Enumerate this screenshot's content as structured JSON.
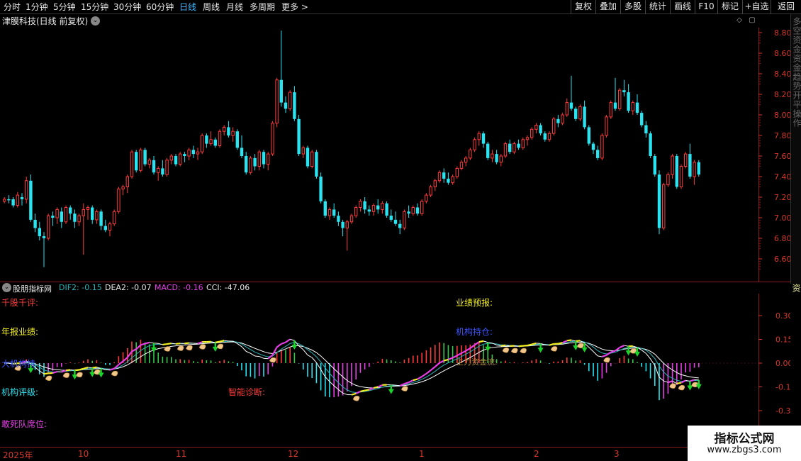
{
  "toolbar": {
    "periods": [
      "分时",
      "1分钟",
      "5分钟",
      "15分钟",
      "30分钟",
      "60分钟",
      "日线",
      "周线",
      "月线",
      "多周期",
      "更多 >"
    ],
    "active_period": "日线",
    "tools": [
      "复权",
      "叠加",
      "多股",
      "统计",
      "画线",
      "F10",
      "标记",
      "+自选",
      "返回"
    ]
  },
  "stock": {
    "title": "津膜科技(日线 前复权)"
  },
  "price_axis": [
    "8.80",
    "8.60",
    "8.40",
    "8.20",
    "8.00",
    "7.80",
    "7.60",
    "7.40",
    "7.20",
    "7.00",
    "6.80",
    "6.60"
  ],
  "indicator": {
    "name": "股朋指标网",
    "dif_label": "DIF2: -0.15",
    "dea_label": "DEA2: -0.07",
    "macd_label": "MACD: -0.16",
    "cci_label": "CCI: -47.06",
    "axis": [
      "0.30",
      "0.15",
      "0.00",
      "-0.15",
      "-0.30"
    ]
  },
  "annotations": {
    "qiangu": "千股千评:",
    "nianbao": "年报业绩:",
    "blue_left": "大机构持",
    "jigou": "机构评级:",
    "zhineng": "智能诊断:",
    "gansi": "敢死队席位:",
    "yeji": "业绩预报:",
    "blue_mid": "机构持仓:",
    "zhuli": "主力资金流:"
  },
  "right_strip": {
    "top_text": "多空资金资金趋势开平操作",
    "bottom_text": "资"
  },
  "dates": [
    "2025年",
    "10",
    "11",
    "12",
    "1",
    "2",
    "3"
  ],
  "watermark": {
    "title": "指标公式网",
    "url": "www.zbgs3.com"
  },
  "colors": {
    "up": "#ff3b3b",
    "down": "#29e3f0",
    "axis": "#d8372a",
    "magenta": "#e83ee8",
    "yellow": "#f5f020",
    "white_line": "#ffffff",
    "teal_line": "#2ab3b8"
  },
  "chart_data": {
    "type": "candlestick",
    "candles": [
      [
        7.16,
        7.2,
        7.14,
        7.18
      ],
      [
        7.18,
        7.22,
        7.14,
        7.17
      ],
      [
        7.18,
        7.2,
        7.1,
        7.12
      ],
      [
        7.12,
        7.25,
        7.1,
        7.22
      ],
      [
        7.2,
        7.24,
        7.12,
        7.18
      ],
      [
        7.18,
        7.4,
        7.14,
        7.36
      ],
      [
        7.36,
        7.42,
        6.96,
        6.98
      ],
      [
        6.98,
        7.04,
        6.86,
        6.9
      ],
      [
        6.9,
        6.96,
        6.78,
        6.82
      ],
      [
        6.82,
        6.86,
        6.52,
        6.8
      ],
      [
        6.8,
        7.04,
        6.78,
        7.02
      ],
      [
        7.02,
        7.06,
        6.92,
        7.0
      ],
      [
        7.0,
        7.1,
        6.94,
        7.08
      ],
      [
        7.06,
        7.1,
        6.9,
        6.96
      ],
      [
        6.96,
        7.12,
        6.94,
        7.1
      ],
      [
        7.1,
        7.12,
        6.98,
        7.04
      ],
      [
        7.04,
        7.08,
        6.9,
        6.96
      ],
      [
        6.96,
        7.04,
        6.92,
        7.02
      ],
      [
        7.02,
        7.14,
        6.64,
        7.08
      ],
      [
        7.08,
        7.12,
        6.98,
        7.1
      ],
      [
        7.1,
        7.12,
        6.94,
        6.98
      ],
      [
        6.98,
        7.08,
        6.94,
        7.06
      ],
      [
        7.06,
        7.08,
        6.88,
        6.92
      ],
      [
        6.92,
        6.98,
        6.86,
        6.88
      ],
      [
        6.88,
        6.96,
        6.82,
        6.94
      ],
      [
        6.94,
        7.08,
        6.92,
        7.06
      ],
      [
        7.06,
        7.3,
        7.04,
        7.28
      ],
      [
        7.28,
        7.32,
        7.22,
        7.3
      ],
      [
        7.3,
        7.42,
        7.24,
        7.4
      ],
      [
        7.4,
        7.66,
        7.38,
        7.64
      ],
      [
        7.64,
        7.66,
        7.44,
        7.46
      ],
      [
        7.46,
        7.68,
        7.44,
        7.66
      ],
      [
        7.66,
        7.68,
        7.5,
        7.52
      ],
      [
        7.52,
        7.58,
        7.48,
        7.56
      ],
      [
        7.56,
        7.6,
        7.42,
        7.44
      ],
      [
        7.44,
        7.5,
        7.36,
        7.48
      ],
      [
        7.48,
        7.56,
        7.4,
        7.42
      ],
      [
        7.42,
        7.58,
        7.4,
        7.56
      ],
      [
        7.56,
        7.62,
        7.52,
        7.6
      ],
      [
        7.6,
        7.62,
        7.5,
        7.52
      ],
      [
        7.52,
        7.64,
        7.5,
        7.62
      ],
      [
        7.62,
        7.64,
        7.54,
        7.6
      ],
      [
        7.6,
        7.68,
        7.56,
        7.66
      ],
      [
        7.66,
        7.7,
        7.58,
        7.62
      ],
      [
        7.62,
        7.68,
        7.56,
        7.64
      ],
      [
        7.64,
        7.82,
        7.62,
        7.8
      ],
      [
        7.8,
        7.82,
        7.68,
        7.72
      ],
      [
        7.72,
        7.84,
        7.7,
        7.76
      ],
      [
        7.76,
        7.78,
        7.68,
        7.7
      ],
      [
        7.7,
        7.86,
        7.68,
        7.84
      ],
      [
        7.84,
        7.9,
        7.8,
        7.88
      ],
      [
        7.88,
        7.94,
        7.78,
        7.8
      ],
      [
        7.8,
        7.88,
        7.74,
        7.84
      ],
      [
        7.84,
        7.86,
        7.66,
        7.68
      ],
      [
        7.68,
        7.8,
        7.58,
        7.6
      ],
      [
        7.6,
        7.64,
        7.42,
        7.44
      ],
      [
        7.44,
        7.6,
        7.42,
        7.58
      ],
      [
        7.58,
        7.62,
        7.46,
        7.5
      ],
      [
        7.5,
        7.66,
        7.46,
        7.64
      ],
      [
        7.64,
        7.66,
        7.48,
        7.52
      ],
      [
        7.52,
        7.64,
        7.46,
        7.62
      ],
      [
        7.62,
        7.94,
        7.6,
        7.92
      ],
      [
        7.92,
        8.36,
        7.88,
        8.34
      ],
      [
        8.34,
        8.82,
        8.08,
        8.12
      ],
      [
        8.12,
        8.18,
        8.02,
        8.06
      ],
      [
        8.06,
        8.24,
        8.04,
        8.22
      ],
      [
        8.22,
        8.28,
        7.94,
        7.96
      ],
      [
        7.96,
        8.0,
        7.6,
        7.62
      ],
      [
        7.62,
        7.7,
        7.58,
        7.68
      ],
      [
        7.68,
        7.7,
        7.48,
        7.5
      ],
      [
        7.5,
        7.66,
        7.48,
        7.64
      ],
      [
        7.64,
        7.66,
        7.38,
        7.4
      ],
      [
        7.4,
        7.44,
        7.14,
        7.16
      ],
      [
        7.16,
        7.18,
        7.0,
        7.02
      ],
      [
        7.02,
        7.1,
        6.98,
        7.08
      ],
      [
        7.08,
        7.14,
        7.0,
        7.02
      ],
      [
        7.02,
        7.06,
        6.92,
        6.96
      ],
      [
        6.96,
        6.98,
        6.82,
        6.9
      ],
      [
        6.9,
        6.98,
        6.68,
        6.96
      ],
      [
        6.96,
        7.04,
        6.94,
        7.02
      ],
      [
        7.02,
        7.12,
        7.0,
        7.1
      ],
      [
        7.1,
        7.18,
        7.06,
        7.16
      ],
      [
        7.16,
        7.2,
        7.04,
        7.08
      ],
      [
        7.08,
        7.12,
        7.02,
        7.06
      ],
      [
        7.06,
        7.14,
        7.02,
        7.12
      ],
      [
        7.12,
        7.18,
        7.04,
        7.08
      ],
      [
        7.08,
        7.16,
        7.04,
        7.14
      ],
      [
        7.14,
        7.16,
        7.0,
        7.02
      ],
      [
        7.02,
        7.08,
        6.96,
        6.98
      ],
      [
        6.98,
        7.06,
        6.92,
        6.94
      ],
      [
        6.94,
        6.98,
        6.84,
        6.9
      ],
      [
        6.9,
        7.08,
        6.88,
        7.06
      ],
      [
        7.06,
        7.12,
        7.0,
        7.04
      ],
      [
        7.04,
        7.12,
        7.02,
        7.1
      ],
      [
        7.1,
        7.14,
        7.02,
        7.04
      ],
      [
        7.04,
        7.18,
        7.02,
        7.16
      ],
      [
        7.16,
        7.24,
        7.14,
        7.22
      ],
      [
        7.22,
        7.32,
        7.2,
        7.3
      ],
      [
        7.3,
        7.38,
        7.26,
        7.36
      ],
      [
        7.36,
        7.46,
        7.34,
        7.44
      ],
      [
        7.44,
        7.48,
        7.34,
        7.38
      ],
      [
        7.38,
        7.44,
        7.32,
        7.34
      ],
      [
        7.34,
        7.42,
        7.32,
        7.4
      ],
      [
        7.4,
        7.5,
        7.38,
        7.48
      ],
      [
        7.48,
        7.56,
        7.46,
        7.54
      ],
      [
        7.54,
        7.6,
        7.5,
        7.58
      ],
      [
        7.58,
        7.68,
        7.56,
        7.66
      ],
      [
        7.66,
        7.78,
        7.64,
        7.76
      ],
      [
        7.76,
        7.84,
        7.7,
        7.82
      ],
      [
        7.82,
        7.84,
        7.68,
        7.72
      ],
      [
        7.72,
        7.74,
        7.56,
        7.58
      ],
      [
        7.58,
        7.66,
        7.54,
        7.62
      ],
      [
        7.62,
        7.66,
        7.52,
        7.54
      ],
      [
        7.54,
        7.62,
        7.5,
        7.6
      ],
      [
        7.6,
        7.74,
        7.58,
        7.72
      ],
      [
        7.72,
        7.76,
        7.62,
        7.64
      ],
      [
        7.64,
        7.74,
        7.62,
        7.72
      ],
      [
        7.72,
        7.76,
        7.66,
        7.68
      ],
      [
        7.68,
        7.78,
        7.66,
        7.76
      ],
      [
        7.76,
        7.8,
        7.7,
        7.78
      ],
      [
        7.78,
        7.88,
        7.76,
        7.86
      ],
      [
        7.86,
        7.92,
        7.82,
        7.9
      ],
      [
        7.9,
        7.92,
        7.8,
        7.82
      ],
      [
        7.82,
        7.84,
        7.74,
        7.76
      ],
      [
        7.76,
        7.84,
        7.74,
        7.82
      ],
      [
        7.82,
        7.98,
        7.8,
        7.96
      ],
      [
        7.96,
        8.0,
        7.88,
        7.92
      ],
      [
        7.92,
        8.02,
        7.9,
        8.0
      ],
      [
        8.0,
        8.16,
        7.98,
        8.12
      ],
      [
        8.12,
        8.38,
        8.04,
        8.06
      ],
      [
        8.06,
        8.08,
        7.94,
        7.96
      ],
      [
        7.96,
        8.1,
        7.94,
        8.08
      ],
      [
        8.08,
        8.14,
        7.86,
        7.88
      ],
      [
        7.88,
        7.9,
        7.7,
        7.72
      ],
      [
        7.72,
        7.74,
        7.62,
        7.66
      ],
      [
        7.66,
        7.7,
        7.56,
        7.58
      ],
      [
        7.58,
        7.82,
        7.56,
        7.8
      ],
      [
        7.8,
        8.0,
        7.78,
        7.98
      ],
      [
        7.98,
        8.14,
        7.96,
        8.12
      ],
      [
        8.12,
        8.36,
        8.04,
        8.06
      ],
      [
        8.06,
        8.26,
        8.04,
        8.24
      ],
      [
        8.24,
        8.34,
        8.18,
        8.22
      ],
      [
        8.22,
        8.3,
        8.02,
        8.04
      ],
      [
        8.04,
        8.14,
        8.0,
        8.12
      ],
      [
        8.12,
        8.2,
        8.0,
        8.02
      ],
      [
        8.02,
        8.04,
        7.88,
        7.9
      ],
      [
        7.9,
        7.94,
        7.78,
        7.82
      ],
      [
        7.82,
        7.84,
        7.58,
        7.6
      ],
      [
        7.6,
        7.62,
        7.4,
        7.42
      ],
      [
        7.42,
        7.46,
        6.84,
        6.9
      ],
      [
        6.9,
        7.34,
        6.88,
        7.32
      ],
      [
        7.32,
        7.44,
        7.3,
        7.42
      ],
      [
        7.42,
        7.62,
        7.38,
        7.6
      ],
      [
        7.6,
        7.62,
        7.28,
        7.3
      ],
      [
        7.3,
        7.52,
        7.28,
        7.5
      ],
      [
        7.5,
        7.64,
        7.48,
        7.62
      ],
      [
        7.62,
        7.72,
        7.38,
        7.4
      ],
      [
        7.4,
        7.56,
        7.32,
        7.54
      ],
      [
        7.54,
        7.56,
        7.4,
        7.42
      ]
    ]
  }
}
